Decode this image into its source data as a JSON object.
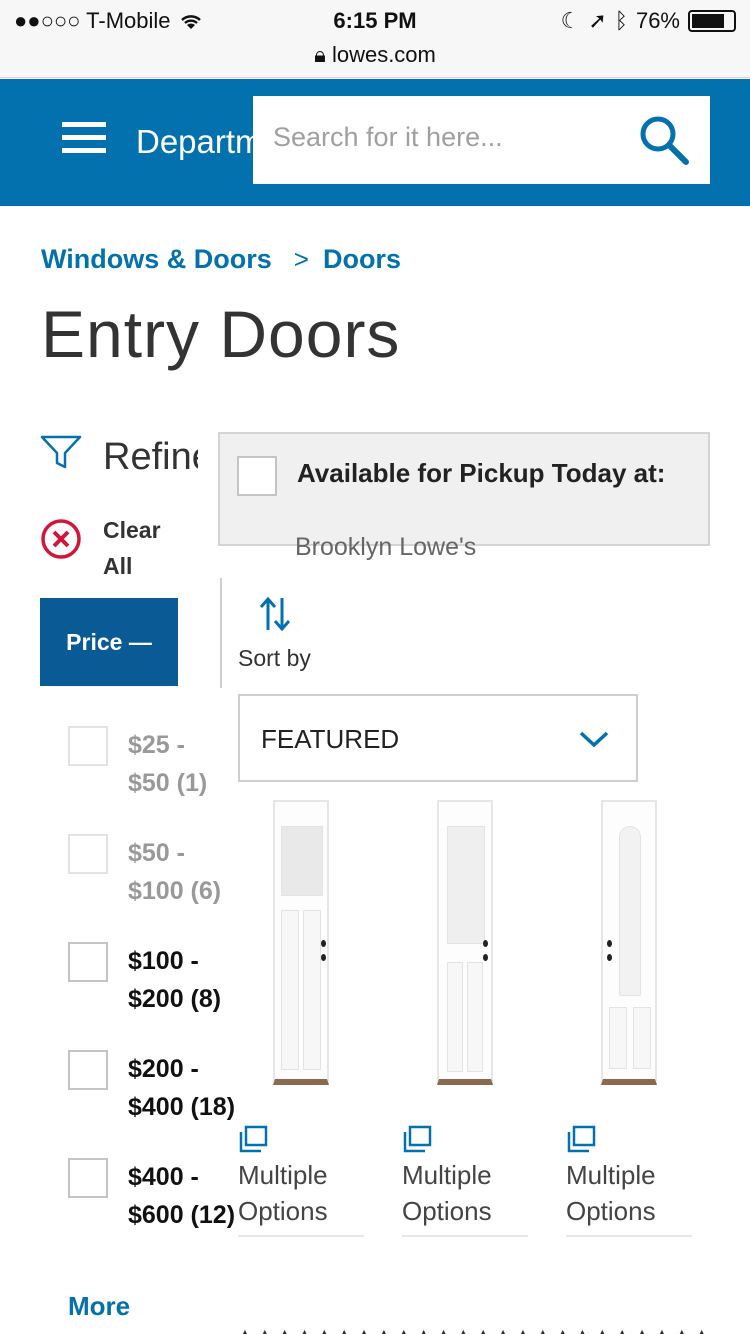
{
  "status_bar": {
    "carrier": "●●○○○ T-Mobile",
    "time": "6:15 PM",
    "battery": "76%",
    "url": "lowes.com"
  },
  "header": {
    "departments_label": "Departments",
    "search_placeholder": "Search for it here..."
  },
  "breadcrumb": [
    "Windows & Doors",
    "Doors"
  ],
  "page_title": "Entry Doors",
  "refine": {
    "label": "Refine",
    "clear_all": "Clear All"
  },
  "pickup": {
    "title": "Available for Pickup Today at:",
    "store": "Brooklyn Lowe's",
    "checked": false
  },
  "price_filter": {
    "label": "Price",
    "options": [
      {
        "line1": "$25 -",
        "line2": "$50 (1)",
        "disabled": true
      },
      {
        "line1": "$50 -",
        "line2": "$100 (6)",
        "disabled": true
      },
      {
        "line1": "$100 -",
        "line2": "$200 (8)",
        "disabled": false
      },
      {
        "line1": "$200 -",
        "line2": "$400 (18)",
        "disabled": false
      },
      {
        "line1": "$400 -",
        "line2": "$600 (12)",
        "disabled": false
      }
    ],
    "more_label": "More"
  },
  "sort": {
    "label": "Sort by",
    "selected": "FEATURED"
  },
  "products": [
    {
      "options_label": "Multiple Options"
    },
    {
      "options_label": "Multiple Options"
    },
    {
      "options_label": "Multiple Options"
    }
  ],
  "colors": {
    "brand_blue": "#0471af",
    "dark_blue": "#0a5a96",
    "clear_red": "#d2153b"
  }
}
